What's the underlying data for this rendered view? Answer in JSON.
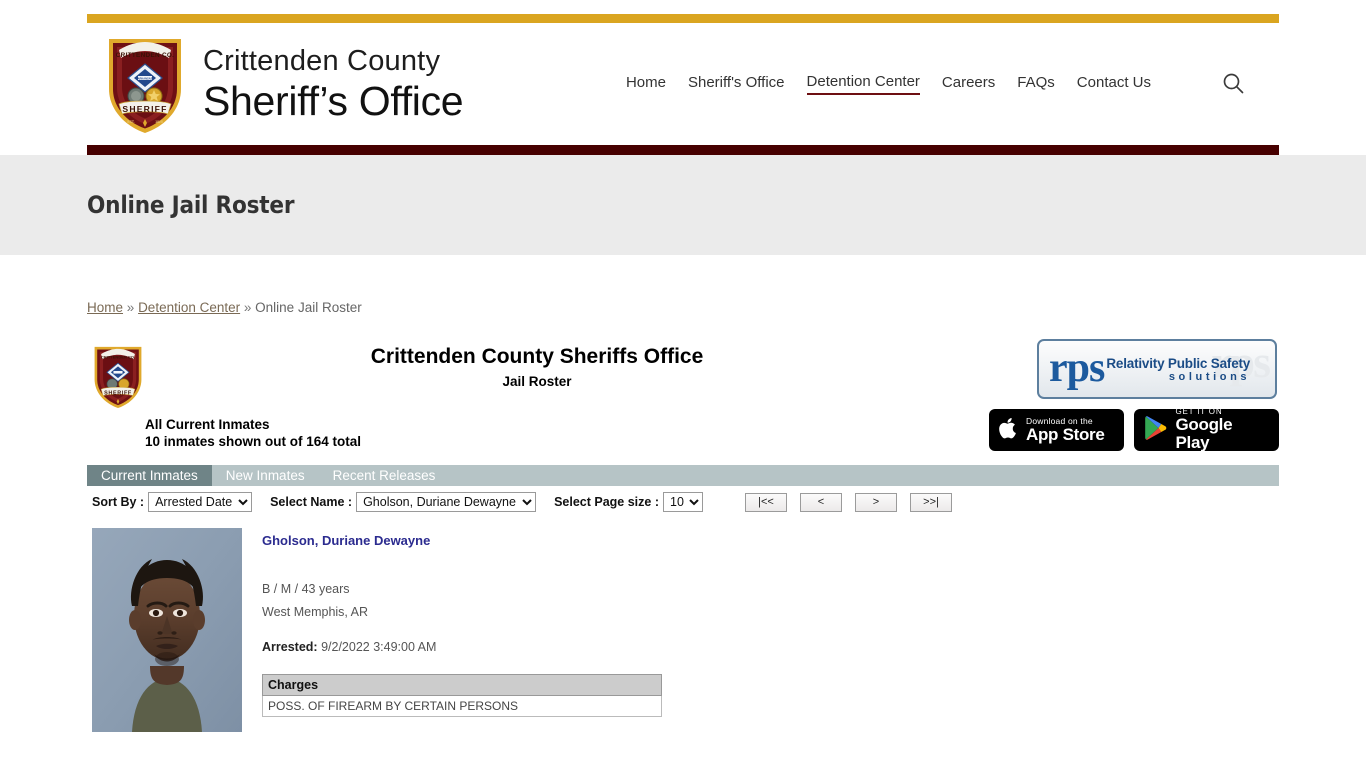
{
  "header": {
    "brand_line1": "Crittenden County",
    "brand_line2": "Sheriff’s Office",
    "badge_top_text": "CRITTENDEN CO.",
    "badge_bottom_text": "SHERIFF",
    "nav": [
      {
        "label": "Home",
        "active": false
      },
      {
        "label": "Sheriff's Office",
        "active": false
      },
      {
        "label": "Detention Center",
        "active": true
      },
      {
        "label": "Careers",
        "active": false
      },
      {
        "label": "FAQs",
        "active": false
      },
      {
        "label": "Contact Us",
        "active": false
      }
    ],
    "search_icon": "search-icon",
    "colors": {
      "top_rule": "#daa520",
      "bottom_rule": "#470000",
      "active_underline": "#6d0f12"
    }
  },
  "page": {
    "title": "Online Jail Roster",
    "title_band_color": "#ebebeb"
  },
  "breadcrumb": {
    "items": [
      {
        "label": "Home",
        "link": true
      },
      {
        "label": "Detention Center",
        "link": true
      },
      {
        "label": "Online Jail Roster",
        "link": false
      }
    ],
    "separator": "»"
  },
  "roster": {
    "title": "Crittenden County Sheriffs Office",
    "subtitle": "Jail Roster",
    "count_line1": "All Current Inmates",
    "count_line2": "10 inmates shown out of 164 total",
    "inmates_shown": 10,
    "inmates_total": 164,
    "logos": {
      "rps_mark": "rps",
      "rps_words_line1": "Relativity Public Safety",
      "rps_words_line2": "solutions",
      "rps_ghost": "rps",
      "apple_small": "Download on the",
      "apple_big": "App Store",
      "google_small": "GET IT ON",
      "google_big": "Google Play"
    },
    "tabs": [
      {
        "label": "Current Inmates",
        "active": true
      },
      {
        "label": "New Inmates",
        "active": false
      },
      {
        "label": "Recent Releases",
        "active": false
      }
    ],
    "filters": {
      "sort_by_label": "Sort By :",
      "sort_by_value": "Arrested Date",
      "sort_by_options": [
        "Arrested Date"
      ],
      "select_name_label": "Select Name :",
      "select_name_value": "Gholson, Duriane Dewayne",
      "select_name_options": [
        "Gholson, Duriane Dewayne"
      ],
      "page_size_label": "Select Page size :",
      "page_size_value": "10",
      "page_size_options": [
        "10"
      ]
    },
    "pager": [
      {
        "label": "|<<",
        "name": "first-page-button"
      },
      {
        "label": "<",
        "name": "prev-page-button"
      },
      {
        "label": ">",
        "name": "next-page-button"
      },
      {
        "label": ">>|",
        "name": "last-page-button"
      }
    ],
    "inmates": [
      {
        "name": "Gholson, Duriane Dewayne",
        "demographics": "B / M / 43 years",
        "city": "West Memphis, AR",
        "arrested_label": "Arrested:",
        "arrested_value": "9/2/2022 3:49:00 AM",
        "charges_header": "Charges",
        "charges": [
          "POSS. OF FIREARM BY CERTAIN PERSONS"
        ]
      }
    ]
  }
}
